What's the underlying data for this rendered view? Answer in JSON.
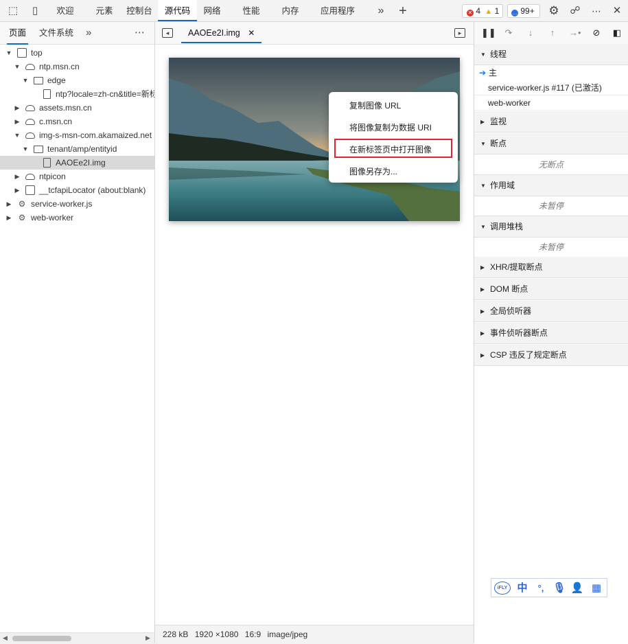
{
  "toolbar": {
    "tabs": [
      "欢迎",
      "元素",
      "控制台",
      "源代码",
      "网络",
      "性能",
      "内存",
      "应用程序"
    ],
    "active_tab": "源代码",
    "errors": "4",
    "warnings": "1",
    "issues": "99+"
  },
  "left_panel": {
    "tabs": [
      "页面",
      "文件系统"
    ],
    "tree": [
      {
        "label": "top",
        "icon": "frame-icon"
      },
      {
        "label": "ntp.msn.cn",
        "icon": "cloud-icon"
      },
      {
        "label": "edge",
        "icon": "folder-icon"
      },
      {
        "label": "ntp?locale=zh-cn&title=新标签页",
        "icon": "file-icon"
      },
      {
        "label": "assets.msn.cn",
        "icon": "cloud-icon"
      },
      {
        "label": "c.msn.cn",
        "icon": "cloud-icon"
      },
      {
        "label": "img-s-msn-com.akamaized.net",
        "icon": "cloud-icon"
      },
      {
        "label": "tenant/amp/entityid",
        "icon": "folder-icon"
      },
      {
        "label": "AAOEe2I.img",
        "icon": "file-icon"
      },
      {
        "label": "ntpicon",
        "icon": "cloud-icon"
      },
      {
        "label": "__tcfapiLocator (about:blank)",
        "icon": "frame-icon"
      },
      {
        "label": "service-worker.js",
        "icon": "gear-file-icon"
      },
      {
        "label": "web-worker",
        "icon": "gear-file-icon"
      }
    ]
  },
  "editor": {
    "file_tab": "AAOEe2I.img",
    "context_menu": [
      "复制图像 URL",
      "将图像复制为数据 URI",
      "在新标签页中打开图像",
      "图像另存为..."
    ],
    "status": {
      "size": "228 kB",
      "dimensions": "1920 ×1080",
      "ratio": "16:9",
      "mime": "image/jpeg"
    }
  },
  "debugger": {
    "threads_title": "线程",
    "threads": [
      "主",
      "service-worker.js #117 (已激活)",
      "web-worker"
    ],
    "watch_title": "监视",
    "breakpoints_title": "断点",
    "breakpoints_note": "无断点",
    "scope_title": "作用域",
    "scope_note": "未暂停",
    "callstack_title": "调用堆栈",
    "callstack_note": "未暂停",
    "xhr_title": "XHR/提取断点",
    "dom_title": "DOM 断点",
    "global_title": "全局侦听器",
    "event_title": "事件侦听器断点",
    "csp_title": "CSP 违反了规定断点"
  },
  "ime": {
    "brand": "iFLY",
    "lang": "中",
    "punct": "°,"
  },
  "colors": {
    "accent": "#0f6cbd",
    "highlight": "#e0252b",
    "error": "#e0312b",
    "warning": "#f2a900",
    "issue": "#2b6ee6"
  }
}
